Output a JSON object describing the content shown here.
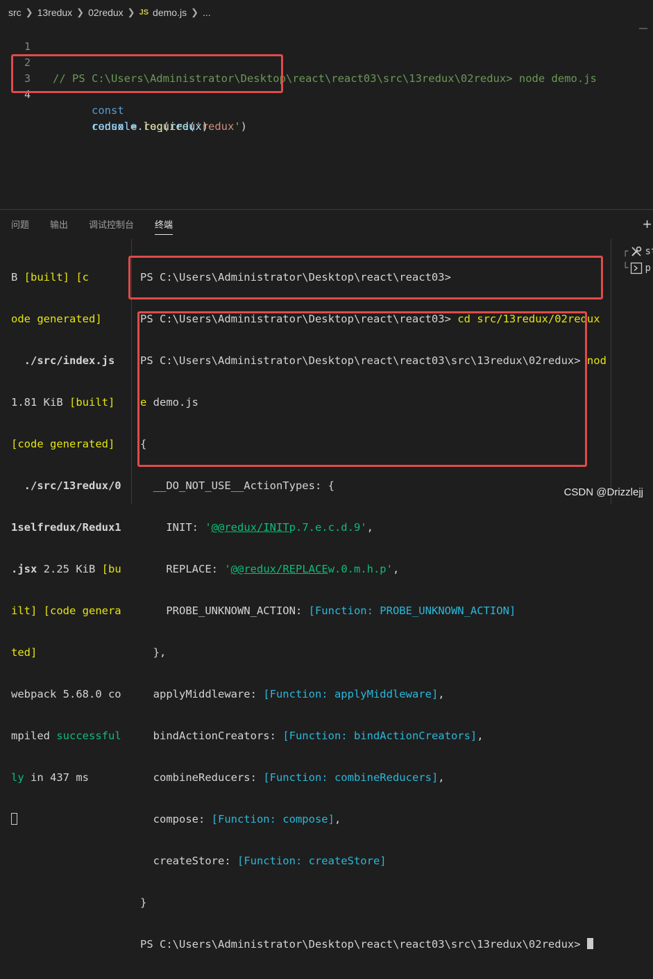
{
  "breadcrumb": {
    "items": [
      "src",
      "13redux",
      "02redux"
    ],
    "file_icon": "JS",
    "file": "demo.js",
    "more": "..."
  },
  "editor": {
    "line_numbers": [
      "1",
      "2",
      "3",
      "4"
    ],
    "line2_comment": "// PS C:\\Users\\Administrator\\Desktop\\react\\react03\\src\\13redux\\02redux> node demo.js",
    "line3": {
      "kw": "const",
      "var": "redux",
      "eq": " = ",
      "fn": "require",
      "open": "(",
      "str": "'redux'",
      "close": ")"
    },
    "line4": {
      "obj": "console",
      "dot": ".",
      "fn": "log",
      "open": "(",
      "var": "redux",
      "close": ")"
    }
  },
  "panel": {
    "tabs": [
      "问题",
      "输出",
      "调试控制台",
      "终端"
    ],
    "active_tab": "终端",
    "plus": "+"
  },
  "terminal_left": {
    "l1_a": "B ",
    "l1_b": "[built]",
    "l1_c": " [c",
    "l2": "ode generated]",
    "l3": "  ./src/index.js",
    "l4_a": "1.81 KiB ",
    "l4_b": "[built]",
    "l5": "[code generated]",
    "l6": "  ./src/13redux/0",
    "l7": "1selfredux/Redux1",
    "l8_a": ".jsx",
    "l8_b": " 2.25 KiB ",
    "l8_c": "[bu",
    "l9_a": "ilt]",
    "l9_b": " [code genera",
    "l10": "ted]",
    "l11": "webpack 5.68.0 co",
    "l12_a": "mpiled ",
    "l12_b": "successful",
    "l13_a": "ly",
    "l13_b": " in 437 ms"
  },
  "terminal_main": {
    "p1": "PS C:\\Users\\Administrator\\Desktop\\react\\react03>",
    "p2_prompt": "PS C:\\Users\\Administrator\\Desktop\\react\\react03> ",
    "p2_cmd": "cd src/13redux/02redux",
    "p3_prompt": "PS C:\\Users\\Administrator\\Desktop\\react\\react03\\src\\13redux\\02redux> ",
    "p3_cmd_a": "nod",
    "p3_cmd_b": "e",
    "p3_cmd_c": " demo.js",
    "o1": "{",
    "o2": "  __DO_NOT_USE__ActionTypes: {",
    "o3_key": "    INIT: ",
    "o3_q1": "'",
    "o3_link": "@@redux/INIT",
    "o3_rest": "p.7.e.c.d.9'",
    "o3_end": ",",
    "o4_key": "    REPLACE: ",
    "o4_q1": "'",
    "o4_link": "@@redux/REPLACE",
    "o4_rest": "w.0.m.h.p'",
    "o4_end": ",",
    "o5_key": "    PROBE_UNKNOWN_ACTION: ",
    "o5_val": "[Function: PROBE_UNKNOWN_ACTION]",
    "o6": "  },",
    "o7_key": "  applyMiddleware: ",
    "o7_val": "[Function: applyMiddleware]",
    "o7_end": ",",
    "o8_key": "  bindActionCreators: ",
    "o8_val": "[Function: bindActionCreators]",
    "o8_end": ",",
    "o9_key": "  combineReducers: ",
    "o9_val": "[Function: combineReducers]",
    "o9_end": ",",
    "o10_key": "  compose: ",
    "o10_val": "[Function: compose]",
    "o10_end": ",",
    "o11_key": "  createStore: ",
    "o11_val": "[Function: createStore]",
    "o12": "}",
    "p4": "PS C:\\Users\\Administrator\\Desktop\\react\\react03\\src\\13redux\\02redux> "
  },
  "side": {
    "item1": "st",
    "item2": "p"
  },
  "watermark": "CSDN @Drizzlejj",
  "colors": {
    "highlight_box": "#e04b4b",
    "background": "#1e1e1e"
  }
}
